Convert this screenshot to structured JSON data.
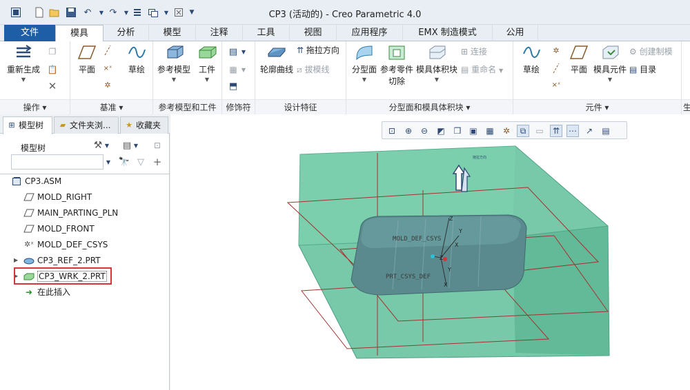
{
  "window": {
    "title": "CP3 (活动的) - Creo Parametric 4.0"
  },
  "quick_access": [
    "window-icon",
    "new-icon",
    "open-icon",
    "save-icon",
    "undo-icon",
    "redo-icon",
    "regenerate-icon",
    "windows-icon",
    "close-window-icon",
    "customize-icon"
  ],
  "tabs": [
    "文件",
    "模具",
    "分析",
    "模型",
    "注释",
    "工具",
    "视图",
    "应用程序",
    "EMX 制造模式",
    "公用"
  ],
  "active_tab": "模具",
  "ribbon": {
    "groups": [
      "操作",
      "基准",
      "参考模型和工件",
      "修饰符",
      "设计特征",
      "分型面和模具体积块",
      "元件",
      "生"
    ],
    "buttons": {
      "regenerate": "重新生成",
      "plane": "平面",
      "sketch": "草绘",
      "ref_model": "参考模型",
      "workpiece": "工件",
      "silhouette": "轮廓曲线",
      "drag_direction": "拖拉方向",
      "draft_line": "拔模线",
      "parting_surface": "分型面",
      "ref_part_cut": "参考零件",
      "ref_part_cut2": "切除",
      "mold_volume": "模具体积块",
      "connect": "连接",
      "rename": "重命名",
      "sketch2": "草绘",
      "plane2": "平面",
      "mold_component": "模具元件",
      "create_casting": "创建制模",
      "catalog": "目录"
    }
  },
  "left_panel": {
    "tabs": [
      "模型树",
      "文件夹浏...",
      "收藏夹"
    ],
    "header": "模型树",
    "search_placeholder": "",
    "tree": [
      {
        "label": "CP3.ASM",
        "type": "asm"
      },
      {
        "label": "MOLD_RIGHT",
        "type": "plane"
      },
      {
        "label": "MAIN_PARTING_PLN",
        "type": "plane"
      },
      {
        "label": "MOLD_FRONT",
        "type": "plane"
      },
      {
        "label": "MOLD_DEF_CSYS",
        "type": "csys"
      },
      {
        "label": "CP3_REF_2.PRT",
        "type": "part"
      },
      {
        "label": "CP3_WRK_2.PRT",
        "type": "workpiece"
      },
      {
        "label": "在此插入",
        "type": "insert"
      }
    ],
    "highlight_color": "#d9343a"
  },
  "viewport": {
    "labels": {
      "pull_direction": "拖拉方向",
      "csys": "MOLD_DEF_CSYS",
      "prt": "PRT_CSYS_DEF",
      "z": "Z",
      "y": "Y",
      "x": "X"
    },
    "workpiece_color": "#5fbf9a",
    "part_color": "#5a8a8e",
    "datum_color": "#a3312f"
  },
  "colors": {
    "file_tab": "#1e5ea6",
    "accent": "#2c4a73"
  }
}
